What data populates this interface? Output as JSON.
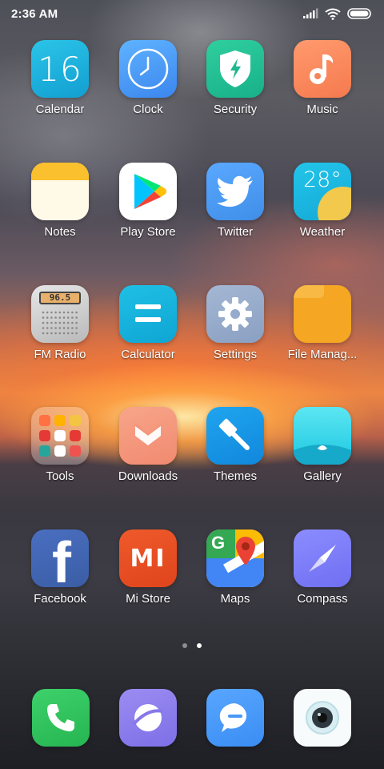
{
  "status_bar": {
    "time": "2:36 AM"
  },
  "apps": [
    {
      "id": "calendar",
      "label": "Calendar",
      "icon": "calendar-icon",
      "text": "16"
    },
    {
      "id": "clock",
      "label": "Clock",
      "icon": "clock-icon"
    },
    {
      "id": "security",
      "label": "Security",
      "icon": "shield-icon"
    },
    {
      "id": "music",
      "label": "Music",
      "icon": "music-note-icon"
    },
    {
      "id": "notes",
      "label": "Notes",
      "icon": "notes-icon"
    },
    {
      "id": "play-store",
      "label": "Play Store",
      "icon": "play-store-icon"
    },
    {
      "id": "twitter",
      "label": "Twitter",
      "icon": "twitter-bird-icon"
    },
    {
      "id": "weather",
      "label": "Weather",
      "icon": "weather-icon",
      "text": "28°"
    },
    {
      "id": "fm-radio",
      "label": "FM Radio",
      "icon": "radio-icon",
      "text": "96.5"
    },
    {
      "id": "calculator",
      "label": "Calculator",
      "icon": "calculator-icon"
    },
    {
      "id": "settings",
      "label": "Settings",
      "icon": "gear-icon"
    },
    {
      "id": "file-manager",
      "label": "File Manag...",
      "icon": "folder-icon"
    },
    {
      "id": "tools",
      "label": "Tools",
      "icon": "folder-grid-icon"
    },
    {
      "id": "downloads",
      "label": "Downloads",
      "icon": "download-icon"
    },
    {
      "id": "themes",
      "label": "Themes",
      "icon": "paintbrush-icon"
    },
    {
      "id": "gallery",
      "label": "Gallery",
      "icon": "gallery-icon"
    },
    {
      "id": "facebook",
      "label": "Facebook",
      "icon": "facebook-icon",
      "text": "f"
    },
    {
      "id": "mi-store",
      "label": "Mi Store",
      "icon": "mi-logo-icon",
      "text": "MI"
    },
    {
      "id": "maps",
      "label": "Maps",
      "icon": "maps-icon",
      "text": "G"
    },
    {
      "id": "compass",
      "label": "Compass",
      "icon": "compass-icon"
    }
  ],
  "page_indicator": {
    "count": 2,
    "active": 2
  },
  "dock": [
    {
      "id": "phone",
      "icon": "phone-icon"
    },
    {
      "id": "browser",
      "icon": "browser-icon"
    },
    {
      "id": "messages",
      "icon": "message-icon"
    },
    {
      "id": "camera",
      "icon": "camera-icon"
    }
  ]
}
